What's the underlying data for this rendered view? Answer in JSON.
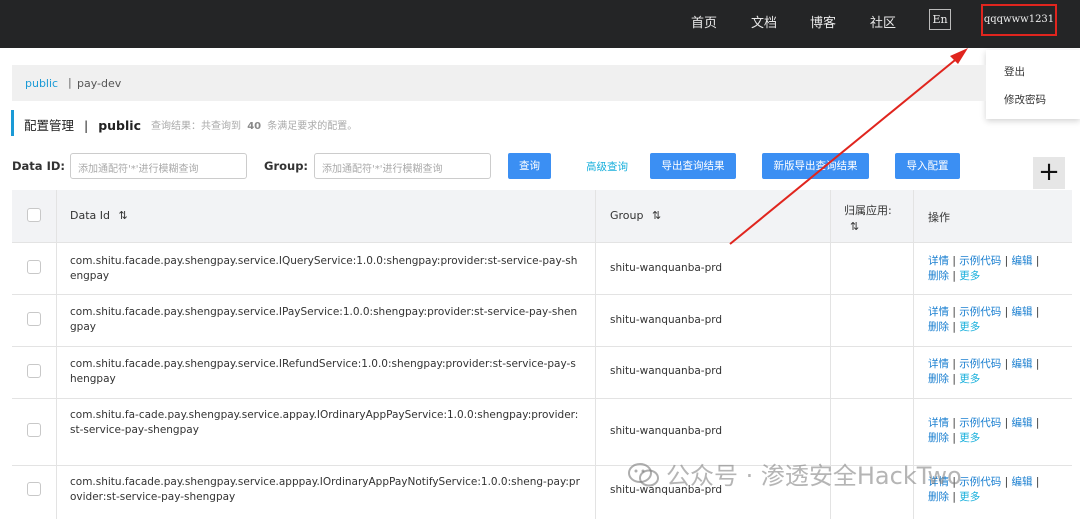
{
  "topbar": {
    "nav": [
      "首页",
      "文档",
      "博客",
      "社区"
    ],
    "lang": "En",
    "user": "qqqwww1231"
  },
  "user_menu": [
    "登出",
    "修改密码"
  ],
  "namespace": {
    "active": "public",
    "separator": "|",
    "other": "pay-dev"
  },
  "page": {
    "title_prefix": "配置管理",
    "title_sep": "|",
    "title_ns": "public",
    "summary_before": "查询结果：共查询到",
    "summary_count": "40",
    "summary_after": "条满足要求的配置。"
  },
  "search": {
    "dataid_label": "Data ID:",
    "dataid_placeholder": "添加通配符'*'进行模糊查询",
    "group_label": "Group:",
    "group_placeholder": "添加通配符'*'进行模糊查询",
    "query_btn": "查询",
    "advanced": "高级查询",
    "export_btn": "导出查询结果",
    "export_new_btn": "新版导出查询结果",
    "import_btn": "导入配置",
    "add_btn": "+"
  },
  "table": {
    "headers": {
      "dataid": "Data Id",
      "group": "Group",
      "app_line1": "归属应用:",
      "ops": "操作"
    },
    "sort_icon": "⇅",
    "rows": [
      {
        "dataid": "com.shitu.facade.pay.shengpay.service.IQueryService:1.0.0:shengpay:provider:st-service-pay-shengpay",
        "group": "shitu-wanquanba-prd"
      },
      {
        "dataid": "com.shitu.facade.pay.shengpay.service.IPayService:1.0.0:shengpay:provider:st-service-pay-shengpay",
        "group": "shitu-wanquanba-prd"
      },
      {
        "dataid": "com.shitu.facade.pay.shengpay.service.IRefundService:1.0.0:shengpay:provider:st-service-pay-shengpay",
        "group": "shitu-wanquanba-prd"
      },
      {
        "dataid": "com.shitu.fa-cade.pay.shengpay.service.appay.IOrdinaryAppPayService:1.0.0:shengpay:provider:st-service-pay-shengpay",
        "group": "shitu-wanquanba-prd"
      },
      {
        "dataid": "com.shitu.facade.pay.shengpay.service.apppay.IOrdinaryAppPayNotifyService:1.0.0:sheng-pay:provider:st-service-pay-shengpay",
        "group": "shitu-wanquanba-prd"
      }
    ],
    "ops": {
      "detail": "详情",
      "sample": "示例代码",
      "edit": "编辑",
      "delete": "删除",
      "more": "更多",
      "sep": "|"
    }
  },
  "watermark": "公众号 · 渗透安全HackTwo",
  "colors": {
    "topbar": "#242526",
    "accent": "#1a9ad6",
    "button": "#3b8ff3",
    "highlight": "#e0251e"
  }
}
